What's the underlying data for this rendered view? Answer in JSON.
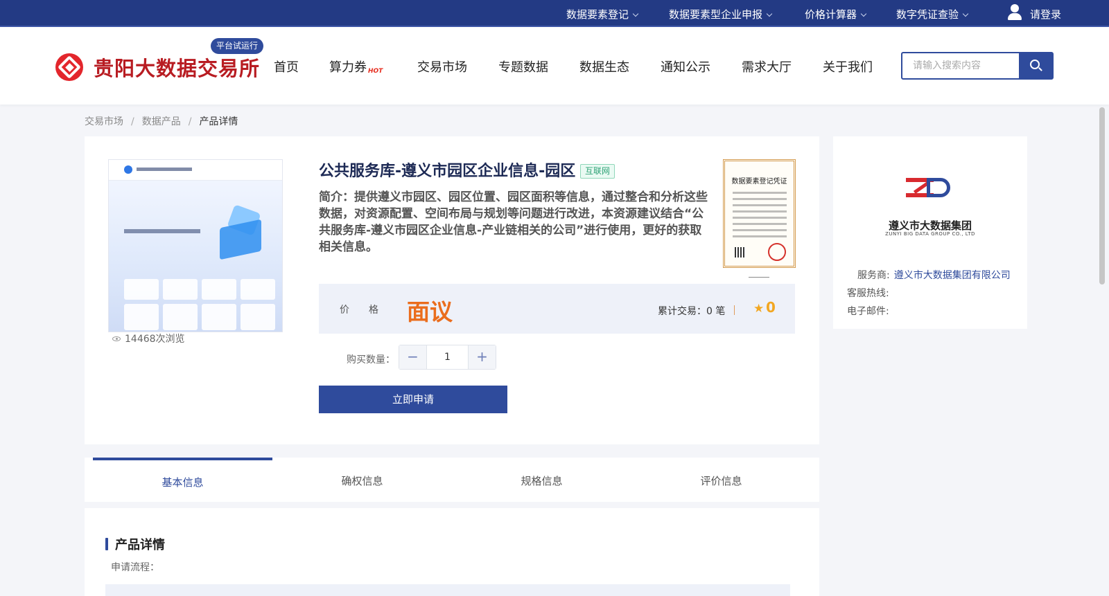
{
  "topbar": {
    "items": [
      "数据要素登记",
      "数据要素型企业申报",
      "价格计算器",
      "数字凭证查验"
    ],
    "login": "请登录"
  },
  "header": {
    "site_name": "贵阳大数据交易所",
    "badge": "平台试运行",
    "nav": [
      "首页",
      "算力券",
      "交易市场",
      "专题数据",
      "数据生态",
      "通知公示",
      "需求大厅",
      "关于我们"
    ],
    "hot_tag": "HOT",
    "search_placeholder": "请输入搜索内容"
  },
  "breadcrumb": [
    "交易市场",
    "数据产品",
    "产品详情"
  ],
  "product": {
    "title": "公共服务库-遵义市园区企业信息-园区",
    "tag": "互联网",
    "summary": "简介：提供遵义市园区、园区位置、园区面积等信息，通过整合和分析这些数据，对资源配置、空间布局与规划等问题进行改进，本资源建议结合“公共服务库-遵义市园区企业信息-产业链相关的公司”进行使用，更好的获取相关信息。",
    "views": "14468次浏览",
    "certificate_title": "数据要素登记凭证",
    "price_label": "价格",
    "price_value": "面议",
    "trade_count": "累计交易：0 笔",
    "rating": "0",
    "quantity_label": "购买数量：",
    "quantity": "1",
    "apply_label": "立即申请"
  },
  "provider": {
    "name": "遵义市大数据集团",
    "name_en": "ZUNYI BIG DATA GROUP CO., LTD",
    "service_label": "服务商:",
    "service_value": "遵义市大数据集团有限公司",
    "hotline_label": "客服热线:",
    "email_label": "电子邮件:"
  },
  "tabs": [
    "基本信息",
    "确权信息",
    "规格信息",
    "评价信息"
  ],
  "detail": {
    "heading": "产品详情",
    "process_label": "申请流程："
  },
  "colors": {
    "primary": "#2f4b9c",
    "topbar": "#233a84",
    "price": "#ea6d1d",
    "brand_red": "#b81c22"
  }
}
